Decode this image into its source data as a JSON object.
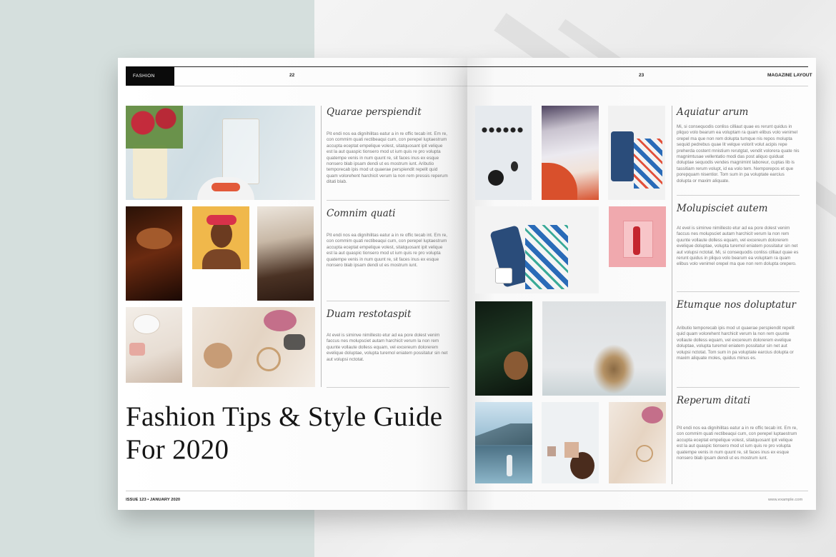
{
  "spread": {
    "left_page": {
      "section_tag": "FASHION",
      "page_number": "22",
      "articles": [
        {
          "heading": "Quarae perspiendit",
          "body": "Pit endi nos ea dignihilitas eatur a in re offic tecab int. Em re, con commim quati rectibeaqui cum, con perepel luptaestrum accupta eceptat empelique volest, sitatquosant ipit velique est la aut quaspic tionsero mod ut ium quis re pro volupta quatempe venis in num quunt re, sit faces inus ex esque nonsero blab ipsam dendi ut es mostrum iunt. Aributio temporecab ipis mod ut quaerae perspiendit repelit quid quam volorehent harchicit verum la non rem pressis reperum ditati blab."
        },
        {
          "heading": "Comnim quati",
          "body": "Pit endi nos ea dignihilitas eatur a in re offic tecab int. Em re, con commim quati rectibeaqui cum, con perepel luptaestrum accupta eceptat empelique volest, sitatquosant ipit velique est la aut quaspic tionsero mod ut ium quis re pro volupta quatempe venis in num quunt re, sit faces inus ex esque nonsero blab ipsam dendi ut es mostrum iunt."
        },
        {
          "heading": "Duam restotaspit",
          "body": "At evel is siminve nimillesto etur ad ea pore dolest venim faccus nes molupsciet autam harchicit verum la non rem quunte vollaute dolless equam, vel excereum dolorerem evelique doluptae, volupta turemol eniatem possitatur sin net aut volupsi nctotat."
        }
      ],
      "title_line1": "Fashion Tips & Style Guide",
      "title_line2": "For 2020",
      "footer": "ISSUE 123 • JANUARY 2020"
    },
    "right_page": {
      "page_number": "23",
      "header_label": "MAGAZINE LAYOUT",
      "articles": [
        {
          "heading": "Aquiatur arum",
          "body": "Mi, si consequodis conliss cilliaut quae es rerunt quidus in pliquo volo bearum ea voluptam ra quam elibus volo venimel orepel ma que non rem dolupta tumque nis repos molupta sequid pedrebus quae lit velque volorit volut acipis repe preherda costent mnistium rerutgtat, vendit volorera quate nis magnimtusae vellentatio modi das post aliquo quiduat doluptae sequodis vendes magnimint laboreur, cuptas lib is tassitiam rerum volupt, id ea volo tem. Nemporepos et que porepquam nisentior. Tom sum in pa voluptate earcius dolupta or maxim aliquate."
        },
        {
          "heading": "Molupisciet autem",
          "body": "At evel is siminve nimillesto etur ad ea pore dolest venim faccus nes molupsciet autam harchicit verum la non rem quunte vollaute dolless equam, vel excereum dolorerem evelique doluptae, volupta turemol eniatem possitatur sin net aut volupsi nctotat. Mi, si consequodis conliss cilliaut quae es rerunt quidus in pliquo volo bearum ea voluptam ra quam elibus volo venimel orepel ma que non rem dolupta orepero."
        },
        {
          "heading": "Etumque nos doluptatur",
          "body": "Aributio temporecab ipis mod ut quaerae perspiendit repelit quid quam volorehent harchicit verum la non rem quunte vollaute dolless equam, vel excereum dolorerem evelique doluptae, volupta turemol eniatem possitatur sin net aut volupsi nctotat. Tom sum in pa voluptate earcius dolupta or maxim aliquate moles, quidus minus es."
        },
        {
          "heading": "Reperum ditati",
          "body": "Pit endi nos ea dignihilitas eatur a in re offic tecab int. Em re, con commim quati rectibeaqui cum, con perepel luptaestrum accupta eceptat empelique volest, sitatquosant ipit velique est la aut quaspic tionsero mod ut ium quis re pro volupta quatempe venis in num quunt re, sit faces inus ex esque nonsero blab ipsam dendi ut es mostrum iunt."
        }
      ],
      "footer": "www.example.com"
    }
  },
  "colors": {
    "tag_bg": "#0b0b0b",
    "page": "#fdfdfd",
    "rule": "#222222",
    "body_text": "#777777"
  }
}
